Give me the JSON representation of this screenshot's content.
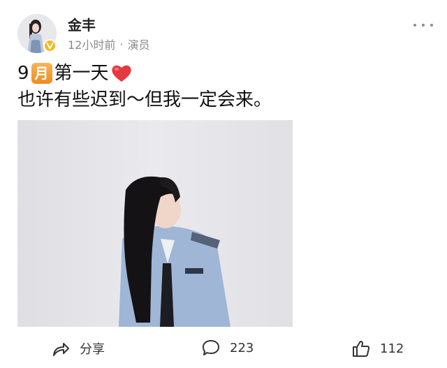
{
  "author": {
    "name": "金丰",
    "time": "12小时前",
    "separator": "·",
    "role": "演员"
  },
  "post": {
    "month_number": "9",
    "month_glyph": "月",
    "day_text": "第一天",
    "line2": "也许有些迟到～但我一定会来。"
  },
  "actions": {
    "share_label": "分享",
    "comment_count": "223",
    "like_count": "112"
  },
  "colors": {
    "badge": "#f5b81c",
    "heart": "#e5393f",
    "month_box": "#f29b2f"
  }
}
